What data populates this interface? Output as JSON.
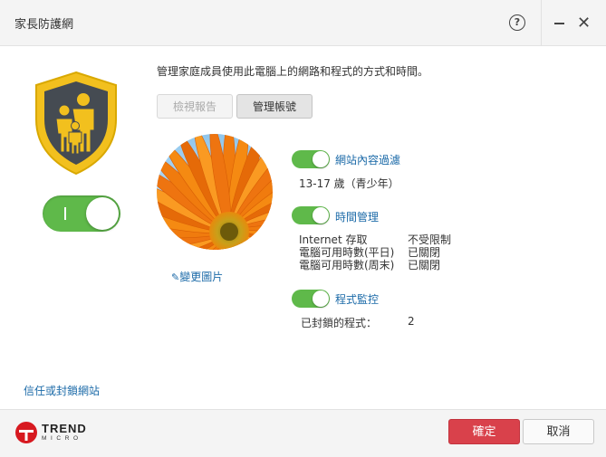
{
  "window": {
    "title": "家長防護網",
    "help_icon": "question-circle-icon",
    "help_symbol": "?",
    "minimize_icon": "minimize-icon",
    "close_icon": "close-icon",
    "close_symbol": "✕"
  },
  "protection": {
    "enabled": true,
    "shield_icon": "family-shield-icon"
  },
  "main": {
    "description": "管理家庭成員使用此電腦上的網路和程式的方式和時間。",
    "view_report_label": "檢視報告",
    "manage_account_label": "管理帳號",
    "change_picture_label": "變更圖片",
    "change_picture_icon": "pencil-icon"
  },
  "features": {
    "web_filter": {
      "label": "網站內容過濾",
      "enabled": true,
      "detail": "13-17 歲（青少年）"
    },
    "time_management": {
      "label": "時間管理",
      "enabled": true,
      "rows": [
        {
          "label": "Internet 存取",
          "value": "不受限制"
        },
        {
          "label": "電腦可用時數(平日)",
          "value": "已關閉"
        },
        {
          "label": "電腦可用時數(周末)",
          "value": "已關閉"
        }
      ]
    },
    "program_control": {
      "label": "程式監控",
      "enabled": true,
      "blocked_label": "已封鎖的程式：",
      "blocked_count": "2"
    }
  },
  "trust_block_link": "信任或封鎖網站",
  "footer": {
    "brand": "TREND",
    "brand_sub": "MICRO",
    "ok_label": "確定",
    "cancel_label": "取消"
  },
  "colors": {
    "accent_green": "#5fb94a",
    "link_blue": "#1b6aa8",
    "ok_red": "#d9414b",
    "shield_yellow": "#f2c01e"
  }
}
